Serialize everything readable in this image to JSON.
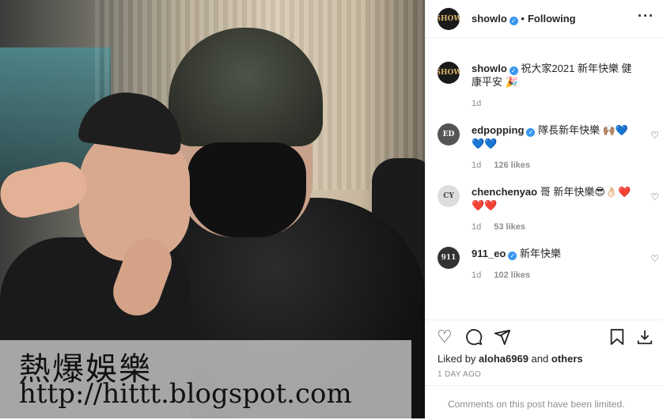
{
  "post": {
    "username": "showlo",
    "follow_state": "Following",
    "avatar_text": "SHOW",
    "caption": "祝大家2021 新年快樂 健康平安 🎉",
    "caption_time": "1d"
  },
  "comments": [
    {
      "username": "edpopping",
      "verified": true,
      "text": "隊長新年快樂 🙌🏽💙💙💙",
      "time": "1d",
      "likes": "126 likes",
      "avatar_text": "ED"
    },
    {
      "username": "chenchenyao",
      "verified": false,
      "text": "哥 新年快樂😎👌🏻❤️❤️❤️",
      "time": "1d",
      "likes": "53 likes",
      "avatar_text": "CY"
    },
    {
      "username": "911_eo",
      "verified": true,
      "text": "新年快樂",
      "time": "1d",
      "likes": "102 likes",
      "avatar_text": "911"
    }
  ],
  "actions": {
    "liked_prefix": "Liked by",
    "liked_user": "aloha6969",
    "liked_and": "and",
    "liked_others": "others",
    "date": "1 DAY AGO",
    "comments_limited": "Comments on this post have been limited."
  },
  "watermark": {
    "title": "熱爆娛樂",
    "url": "http://hittt.blogspot.com"
  },
  "icons": {
    "heart": "heart-icon",
    "comment": "comment-icon",
    "share": "share-icon",
    "save": "bookmark-icon",
    "download": "download-icon"
  },
  "colors": {
    "verified": "#3897f0",
    "muted": "#8e8e8e",
    "text": "#262626"
  }
}
